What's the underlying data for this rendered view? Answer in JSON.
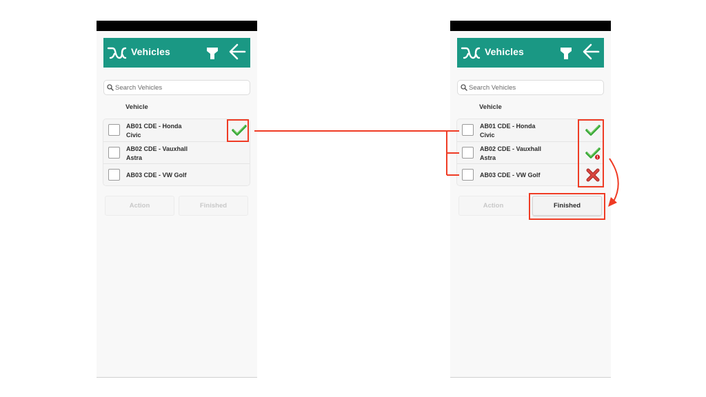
{
  "screens": [
    {
      "id": "before",
      "app_bar": {
        "title": "Vehicles",
        "logo_icon": "wave-logo-icon",
        "filter_icon": "filter-icon",
        "back_icon": "back-arrow-icon"
      },
      "search": {
        "placeholder": "Search Vehicles",
        "value": ""
      },
      "list_header": "Vehicle",
      "vehicles": [
        {
          "label": "AB01 CDE - Honda Civic",
          "line1": "AB01 CDE - Honda",
          "line2": "Civic",
          "checked": false,
          "status": "complete"
        },
        {
          "label": "AB02 CDE - Vauxhall Astra",
          "line1": "AB02 CDE - Vauxhall",
          "line2": "Astra",
          "checked": false,
          "status": "none"
        },
        {
          "label": "AB03 CDE - VW Golf",
          "line1": "AB03 CDE - VW Golf",
          "line2": "",
          "checked": false,
          "status": "none"
        }
      ],
      "buttons": {
        "action": "Action",
        "finished": "Finished"
      },
      "buttons_state": {
        "action_enabled": false,
        "finished_enabled": false
      }
    },
    {
      "id": "after",
      "app_bar": {
        "title": "Vehicles",
        "logo_icon": "wave-logo-icon",
        "filter_icon": "filter-icon",
        "back_icon": "back-arrow-icon"
      },
      "search": {
        "placeholder": "Search Vehicles",
        "value": ""
      },
      "list_header": "Vehicle",
      "vehicles": [
        {
          "label": "AB01 CDE - Honda Civic",
          "line1": "AB01 CDE - Honda",
          "line2": "Civic",
          "checked": false,
          "status": "complete"
        },
        {
          "label": "AB02 CDE - Vauxhall Astra",
          "line1": "AB02 CDE - Vauxhall",
          "line2": "Astra",
          "checked": false,
          "status": "complete-with-defect"
        },
        {
          "label": "AB03 CDE - VW Golf",
          "line1": "AB03 CDE - VW Golf",
          "line2": "",
          "checked": false,
          "status": "failed"
        }
      ],
      "buttons": {
        "action": "Action",
        "finished": "Finished"
      },
      "buttons_state": {
        "action_enabled": false,
        "finished_enabled": true
      }
    }
  ],
  "annotations": {
    "color": "#ef3b24",
    "items": [
      "highlight-status-before",
      "connector-line",
      "highlight-status-column-after",
      "highlight-finished-button",
      "curved-arrow-to-finished"
    ]
  },
  "colors": {
    "app_bar": "#1a9884",
    "check_green": "#3aa83a",
    "cross_red": "#d23b35",
    "defect_dot": "#d0262b"
  }
}
